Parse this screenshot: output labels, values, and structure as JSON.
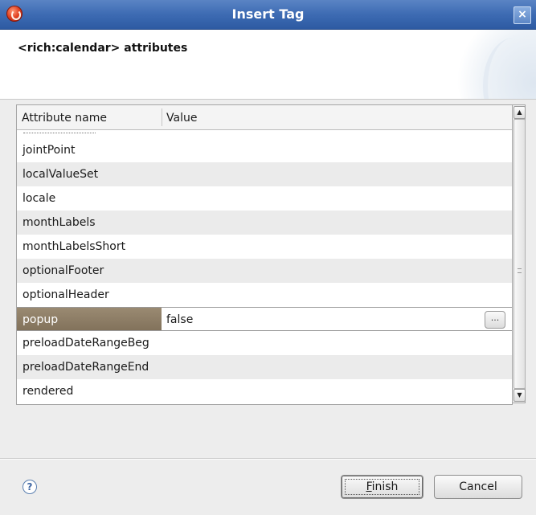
{
  "window": {
    "title": "Insert Tag",
    "close_glyph": "×",
    "icon": "eclipse-app-icon"
  },
  "header": {
    "title": "<rich:calendar> attributes"
  },
  "table": {
    "columns": [
      "Attribute name",
      "Value"
    ],
    "rows": [
      {
        "name": "jointPoint",
        "value": ""
      },
      {
        "name": "localValueSet",
        "value": ""
      },
      {
        "name": "locale",
        "value": ""
      },
      {
        "name": "monthLabels",
        "value": ""
      },
      {
        "name": "monthLabelsShort",
        "value": ""
      },
      {
        "name": "optionalFooter",
        "value": ""
      },
      {
        "name": "optionalHeader",
        "value": ""
      },
      {
        "name": "popup",
        "value": "false",
        "selected": true
      },
      {
        "name": "preloadDateRangeBeg",
        "value": ""
      },
      {
        "name": "preloadDateRangeEnd",
        "value": ""
      },
      {
        "name": "rendered",
        "value": ""
      }
    ],
    "ellipsis_label": "..."
  },
  "scrollbar": {
    "up_glyph": "▲",
    "down_glyph": "▼"
  },
  "footer": {
    "help_glyph": "?",
    "finish_mnemonic": "F",
    "finish_rest": "inish",
    "cancel_label": "Cancel"
  },
  "colors": {
    "titlebar": "#3d6bb3",
    "selected_cell": "#8a7a62",
    "row_stripe": "#ebebeb"
  }
}
